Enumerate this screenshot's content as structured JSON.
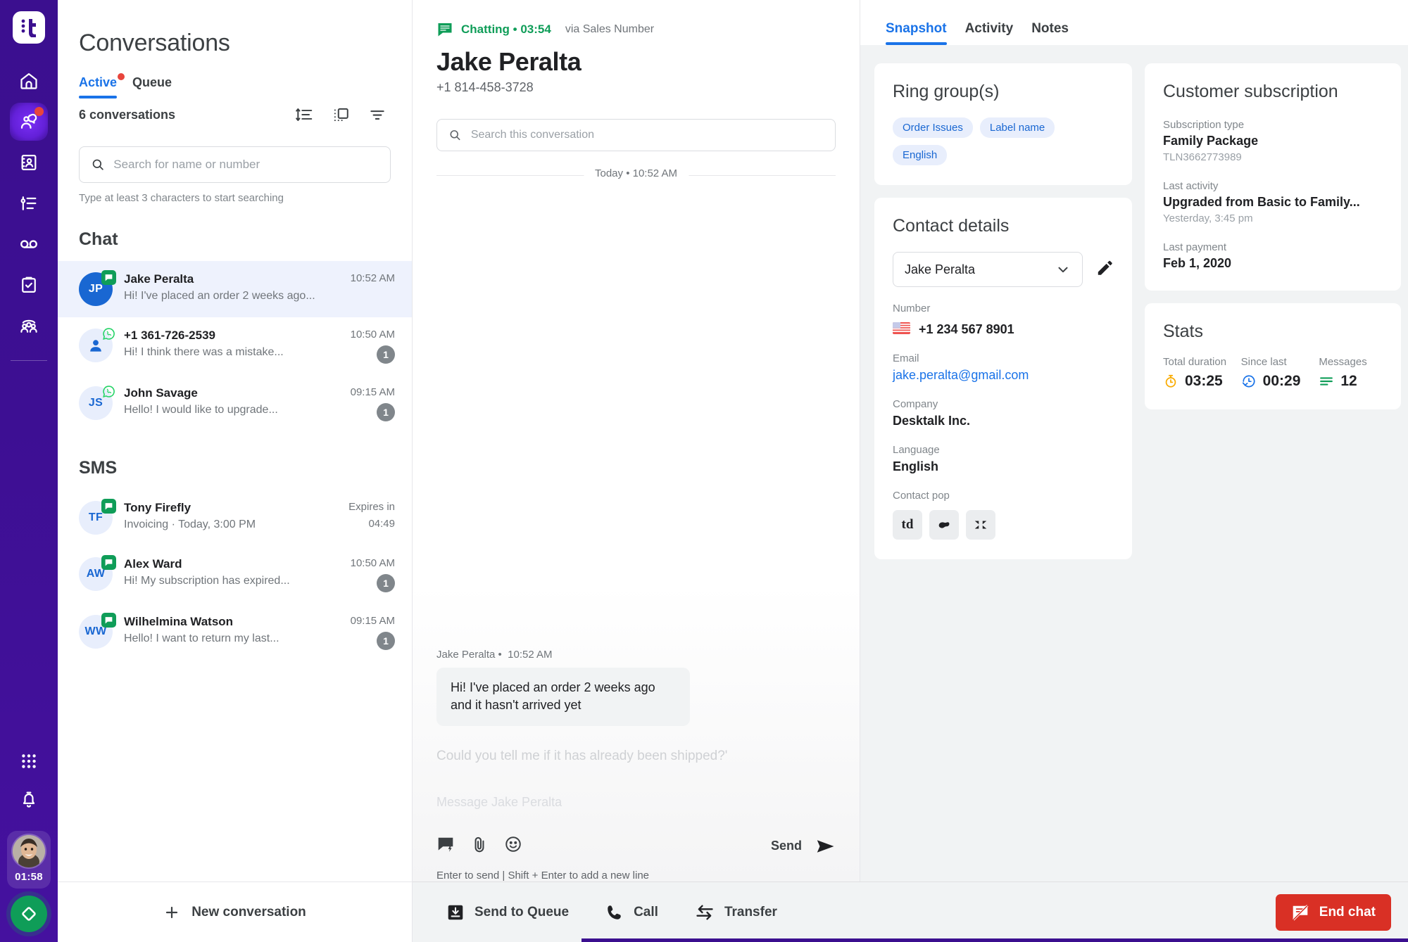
{
  "rail": {
    "logo_alt": "telnyx-logo",
    "items": [
      {
        "name": "home-icon",
        "label": "Home",
        "active": false,
        "dot": false
      },
      {
        "name": "conversations-icon",
        "label": "Conversations",
        "active": true,
        "dot": true
      },
      {
        "name": "contacts-icon",
        "label": "Contacts",
        "active": false,
        "dot": false
      },
      {
        "name": "queues-icon",
        "label": "Queues",
        "active": false,
        "dot": false
      },
      {
        "name": "voicemail-icon",
        "label": "Voicemail",
        "active": false,
        "dot": false
      },
      {
        "name": "tasks-icon",
        "label": "Tasks",
        "active": false,
        "dot": false
      },
      {
        "name": "teams-icon",
        "label": "Teams",
        "active": false,
        "dot": false
      }
    ],
    "apps_label": "Apps",
    "notifications_label": "Notifications",
    "timer": "01:58",
    "status_label": "Available"
  },
  "conversations": {
    "title": "Conversations",
    "tabs": [
      {
        "label": "Active",
        "active": true,
        "dot": true
      },
      {
        "label": "Queue",
        "active": false,
        "dot": false
      }
    ],
    "count_label": "6 conversations",
    "tools": [
      {
        "name": "sort-icon",
        "label": "Sort"
      },
      {
        "name": "layout-icon",
        "label": "Layout"
      },
      {
        "name": "filter-icon",
        "label": "Filter"
      }
    ],
    "search": {
      "placeholder": "Search for name or number",
      "value": ""
    },
    "search_hint": "Type at least 3 characters to start searching",
    "groups": [
      {
        "heading": "Chat",
        "items": [
          {
            "initials": "JP",
            "avatar_style": "blue",
            "channel": "chat",
            "name": "Jake Peralta",
            "preview": "Hi! I've placed an order 2 weeks ago...",
            "time": "10:52 AM",
            "unread": "",
            "selected": true,
            "expires": ""
          },
          {
            "initials": "",
            "avatar_style": "person",
            "channel": "whatsapp",
            "name": "+1 361-726-2539",
            "preview": "Hi! I think there was a mistake...",
            "time": "10:50 AM",
            "unread": "1",
            "selected": false,
            "expires": ""
          },
          {
            "initials": "JS",
            "avatar_style": "light",
            "channel": "whatsapp",
            "name": "John Savage",
            "preview": "Hello! I would like to upgrade...",
            "time": "09:15 AM",
            "unread": "1",
            "selected": false,
            "expires": ""
          }
        ]
      },
      {
        "heading": "SMS",
        "items": [
          {
            "initials": "TF",
            "avatar_style": "light",
            "channel": "chat",
            "name": "Tony Firefly",
            "preview": "Invoicing · Today, 3:00 PM",
            "time": "Expires in",
            "unread": "",
            "selected": false,
            "expires": "04:49"
          },
          {
            "initials": "AW",
            "avatar_style": "light",
            "channel": "chat",
            "name": "Alex Ward",
            "preview": "Hi! My subscription has expired...",
            "time": "10:50 AM",
            "unread": "1",
            "selected": false,
            "expires": ""
          },
          {
            "initials": "WW",
            "avatar_style": "light",
            "channel": "chat",
            "name": "Wilhelmina Watson",
            "preview": "Hello! I want to return my last...",
            "time": "09:15 AM",
            "unread": "1",
            "selected": false,
            "expires": ""
          }
        ]
      }
    ],
    "new_conversation_label": "New conversation"
  },
  "chat": {
    "status": "Chatting • 03:54",
    "via": "via Sales Number",
    "name": "Jake Peralta",
    "phone": "+1 814-458-3728",
    "search_placeholder": "Search this conversation",
    "search_value": "",
    "day_stamp": "Today • 10:52 AM",
    "message": {
      "author": "Jake Peralta •",
      "time": "10:52 AM",
      "text": "Hi! I've placed an order 2 weeks ago and it hasn't arrived yet"
    },
    "suggestion": "Could you tell me if it has already been shipped?'",
    "composer_placeholder": "Message Jake Peralta",
    "composer_value": "",
    "icons": [
      {
        "name": "canned-response-icon",
        "label": "Canned response"
      },
      {
        "name": "attachment-icon",
        "label": "Attach file"
      },
      {
        "name": "emoji-icon",
        "label": "Emoji"
      }
    ],
    "send_label": "Send",
    "hint": "Enter to send | Shift + Enter to add a new line"
  },
  "right_panel": {
    "tabs": [
      {
        "label": "Snapshot",
        "active": true
      },
      {
        "label": "Activity",
        "active": false
      },
      {
        "label": "Notes",
        "active": false
      }
    ],
    "ring_groups": {
      "title": "Ring group(s)",
      "chips": [
        "Order Issues",
        "Label name",
        "English"
      ]
    },
    "contact_details": {
      "title": "Contact details",
      "selected_contact": "Jake Peralta",
      "edit_label": "Edit contact",
      "fields": [
        {
          "label": "Number",
          "value": "+1 234 567 8901",
          "type": "number"
        },
        {
          "label": "Email",
          "value": "jake.peralta@gmail.com",
          "type": "link"
        },
        {
          "label": "Company",
          "value": "Desktalk Inc.",
          "type": "bold"
        },
        {
          "label": "Language",
          "value": "English",
          "type": "bold"
        }
      ],
      "contact_pop_label": "Contact pop",
      "contact_pop_apps": [
        "td",
        "hubspot",
        "zendesk"
      ]
    },
    "subscription": {
      "title": "Customer subscription",
      "rows": [
        {
          "label": "Subscription type",
          "value": "Family Package",
          "sub": "TLN3662773989"
        },
        {
          "label": "Last activity",
          "value": "Upgraded from Basic to Family...",
          "sub": "Yesterday, 3:45 pm"
        },
        {
          "label": "Last payment",
          "value": "Feb 1, 2020",
          "sub": ""
        }
      ]
    },
    "stats": {
      "title": "Stats",
      "items": [
        {
          "label": "Total duration",
          "value": "03:25",
          "icon": "stopwatch-icon"
        },
        {
          "label": "Since last",
          "value": "00:29",
          "icon": "history-icon"
        },
        {
          "label": "Messages",
          "value": "12",
          "icon": "messages-icon"
        }
      ]
    }
  },
  "bottom_bar": {
    "actions": [
      {
        "label": "Send to Queue",
        "icon": "send-to-queue-icon"
      },
      {
        "label": "Call",
        "icon": "phone-icon"
      },
      {
        "label": "Transfer",
        "icon": "transfer-icon"
      }
    ],
    "end_chat_label": "End chat",
    "end_chat_color": "#d93025"
  }
}
